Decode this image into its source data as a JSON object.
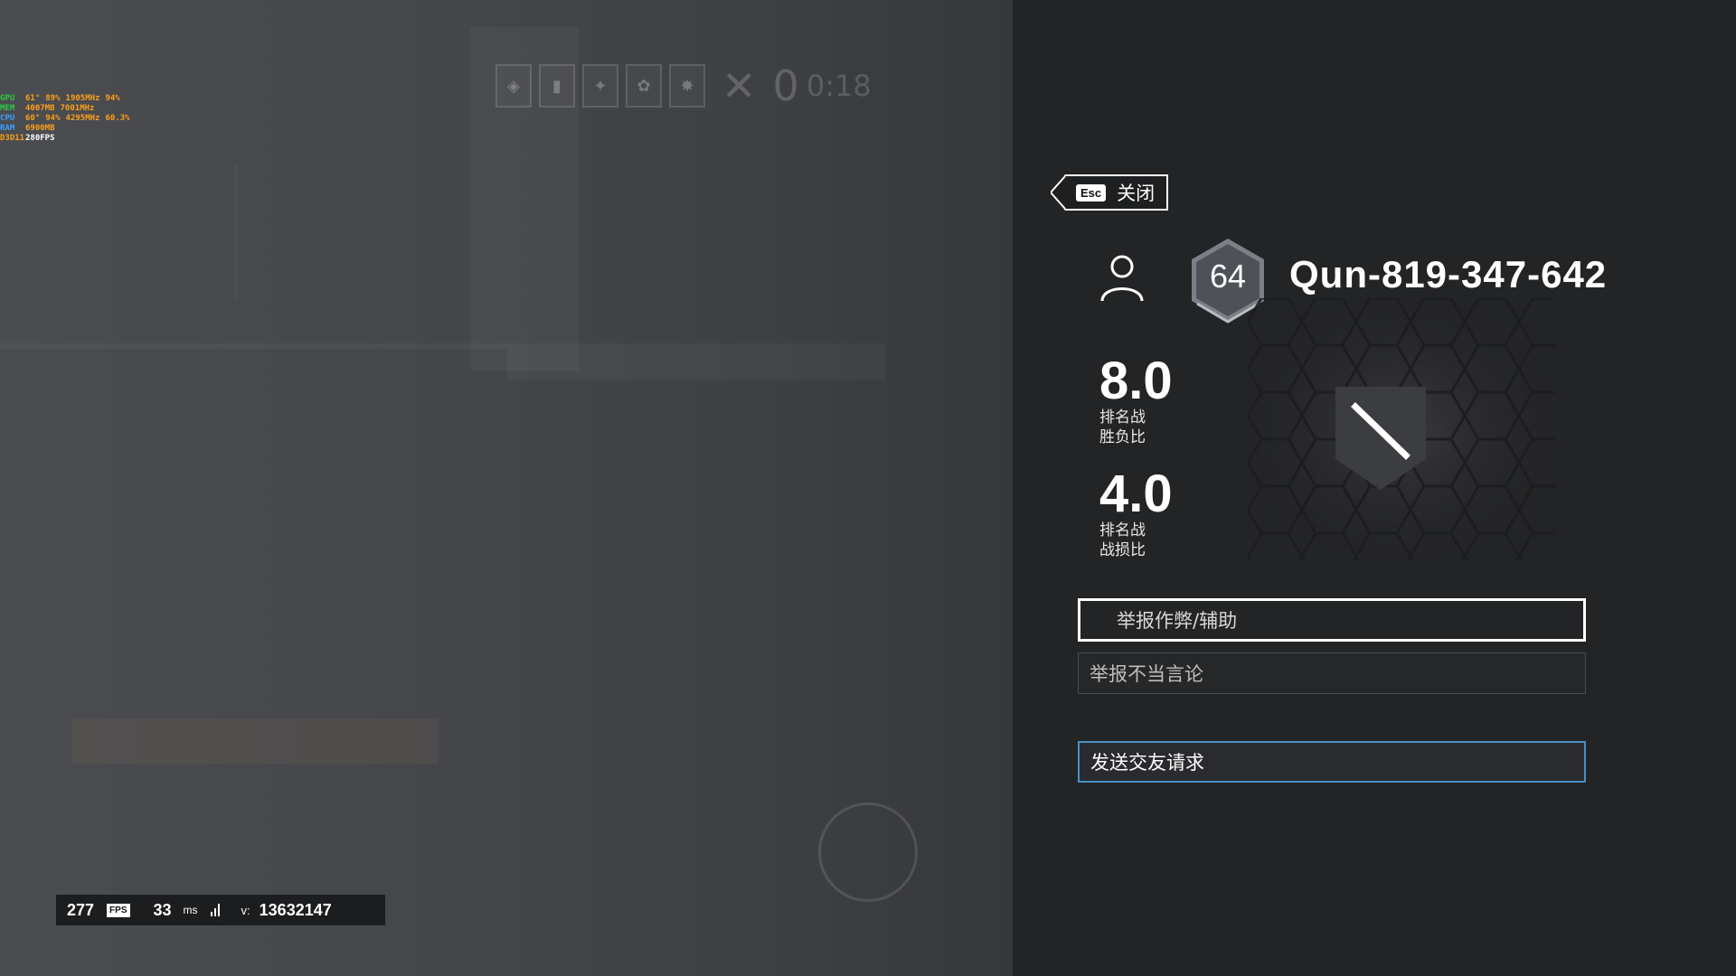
{
  "osd": {
    "rows": [
      {
        "label": "GPU",
        "v1": "61°",
        "v2": "89%",
        "v3": "1905MHz",
        "v4": "94%",
        "color": "#2ecc40"
      },
      {
        "label": "MEM",
        "v1": "4007MB",
        "v2": "7001MHz",
        "v3": "",
        "v4": "",
        "color": "#2ecc40"
      },
      {
        "label": "CPU",
        "v1": "60°",
        "v2": "94%",
        "v3": "4295MHz",
        "v4": "60.3%",
        "color": "#3aa0ff"
      },
      {
        "label": "RAM",
        "v1": "6900MB",
        "v2": "",
        "v3": "",
        "v4": "",
        "color": "#3aa0ff"
      },
      {
        "label": "D3D11",
        "v1": "280FPS",
        "v2": "",
        "v3": "",
        "v4": "",
        "color": "#ff9f1a"
      }
    ],
    "value_color": "#ff9f1a"
  },
  "hud": {
    "score": "0",
    "timer": "0:18"
  },
  "perf": {
    "fps": "277",
    "fps_badge": "FPS",
    "ping": "33",
    "ping_unit": "ms",
    "version_label": "v:",
    "version": "13632147"
  },
  "panel": {
    "esc_key": "Esc",
    "close_label": "关闭",
    "level": "64",
    "player_name": "Qun-819-347-642",
    "stats": [
      {
        "value": "8.0",
        "label_line1": "排名战",
        "label_line2": "胜负比"
      },
      {
        "value": "4.0",
        "label_line1": "排名战",
        "label_line2": "战损比"
      }
    ],
    "buttons": {
      "report_cheat": "举报作弊/辅助",
      "report_speech": "举报不当言论",
      "send_friend": "发送交友请求"
    },
    "colors": {
      "panel_bg": "#232426",
      "accent_blue": "#4a8fc4"
    }
  }
}
